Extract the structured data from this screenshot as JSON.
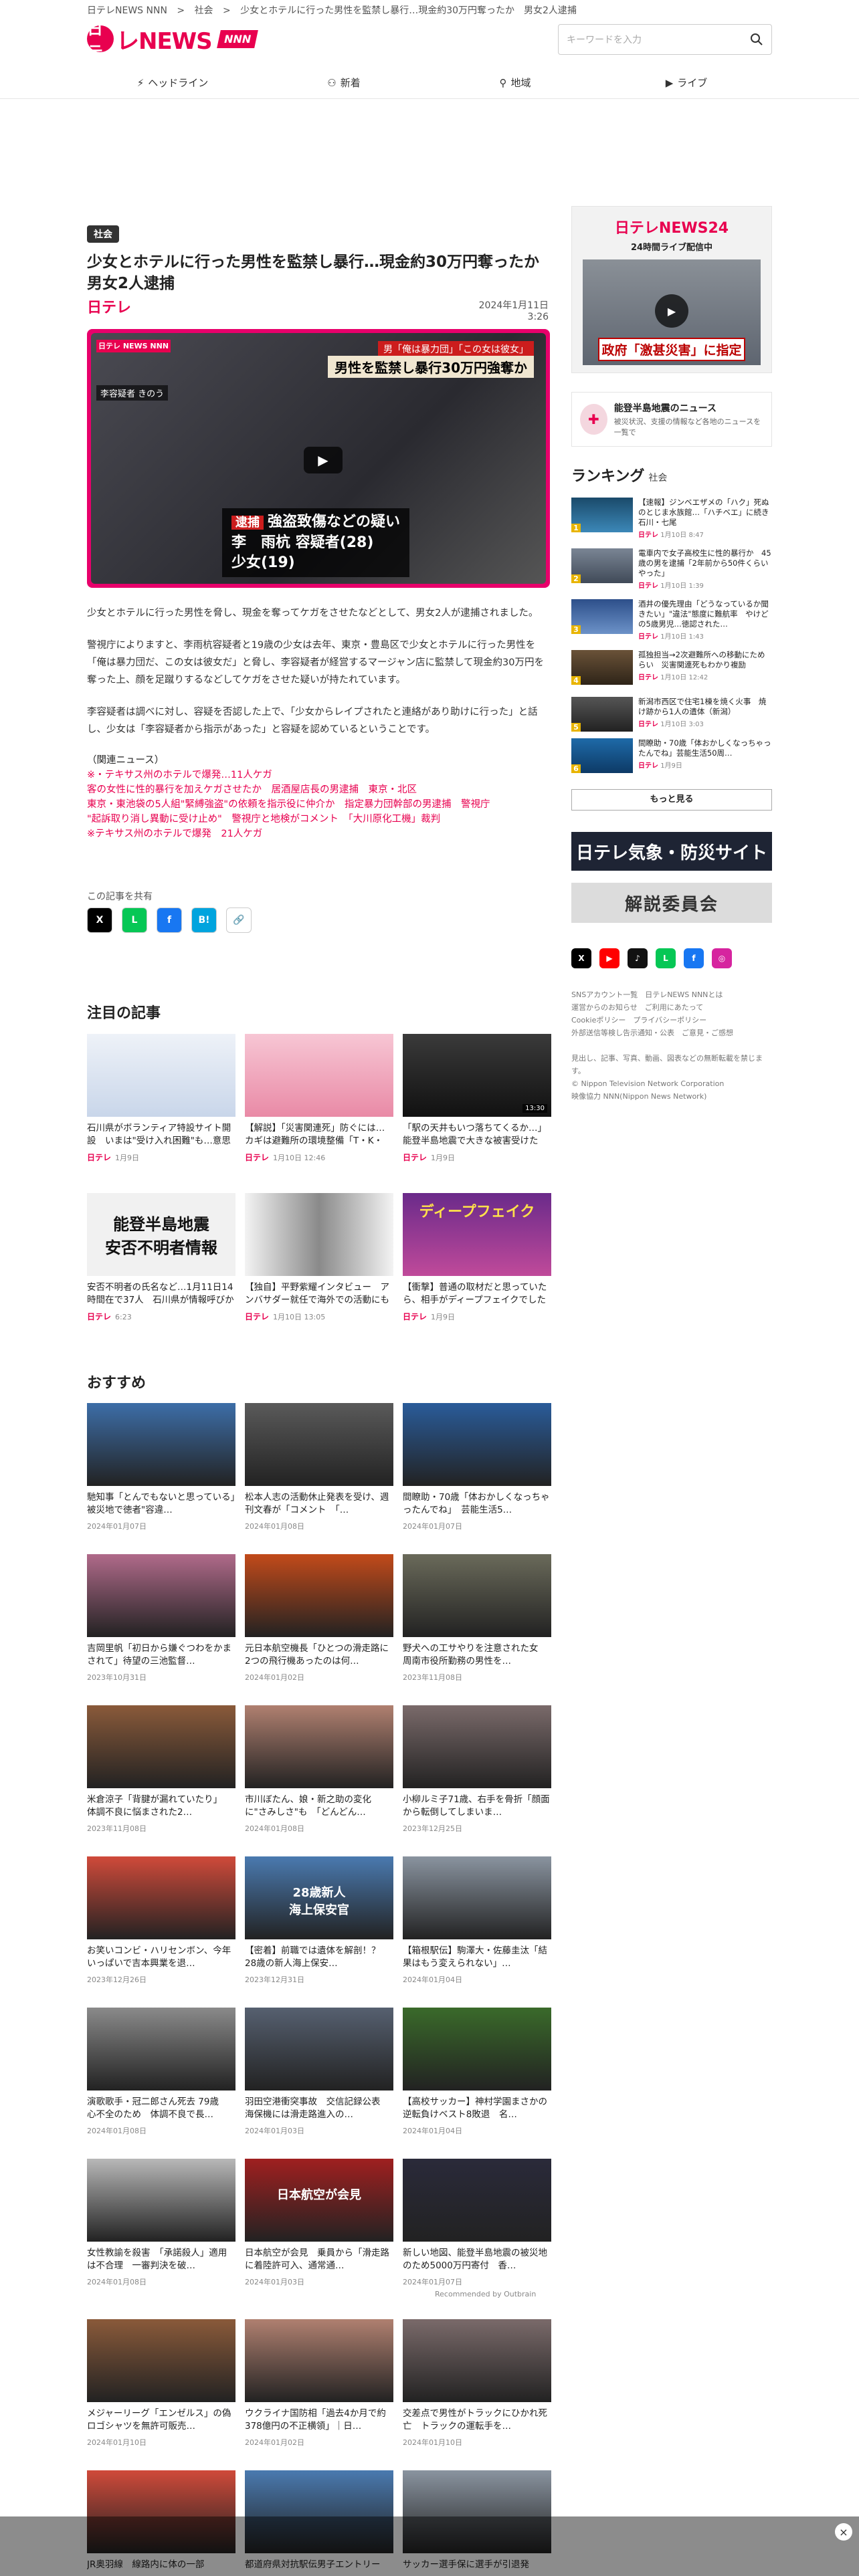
{
  "breadcrumb": [
    "日テレNEWS NNN",
    ">",
    "社会",
    ">",
    "少女とホテルに行った男性を監禁し暴行…現金約30万円奪ったか　男女2人逮捕"
  ],
  "logo": {
    "part1": "日テ",
    "part2": "レNEWS",
    "part3": "NNN"
  },
  "search": {
    "placeholder": "キーワードを入力"
  },
  "nav": [
    {
      "icon": "⚡",
      "label": "ヘッドライン"
    },
    {
      "icon": "⚇",
      "label": "新着"
    },
    {
      "icon": "⚲",
      "label": "地域"
    },
    {
      "icon": "▶",
      "label": "ライブ"
    }
  ],
  "article": {
    "category": "社会",
    "title": "少女とホテルに行った男性を監禁し暴行…現金約30万円奪ったか　男女2人逮捕",
    "brand": "日テレ",
    "date": "2024年1月11日 3:26",
    "hero": {
      "brand_badge": "日テレ NEWS NNN",
      "suspect": "李容疑者 きのう",
      "caption_top": "男「俺は暴力団」「この女は彼女」",
      "caption_main": "男性を監禁し暴行30万円強奪か",
      "arrest": "逮捕",
      "charge": "強盗致傷などの疑い",
      "name1": "李　雨杭 容疑者(28)",
      "name2": "少女(19)"
    },
    "paragraphs": [
      "少女とホテルに行った男性を脅し、現金を奪ってケガをさせたなどとして、男女2人が逮捕されました。",
      "警視庁によりますと、李雨杭容疑者と19歳の少女は去年、東京・豊島区で少女とホテルに行った男性を「俺は暴力団だ、この女は彼女だ」と脅し、李容疑者が経営するマージャン店に監禁して現金約30万円を奪った上、顔を足蹴りするなどしてケガをさせた疑いが持たれています。",
      "李容疑者は調べに対し、容疑を否認した上で、「少女からレイプされたと連絡があり助けに行った」と話し、少女は「李容疑者から指示があった」と容疑を認めているということです。"
    ],
    "related_heading": "（関連ニュース）",
    "related": [
      "※・テキサス州のホテルで爆発…11人ケガ",
      "客の女性に性的暴行を加えケガさせたか　居酒屋店長の男逮捕　東京・北区",
      "東京・東池袋の5人組\"緊縛強盗\"の依頼を指示役に仲介か　指定暴力団幹部の男逮捕　警視庁",
      "\"起訴取り消し異動に受け止め\"　警視庁と地検がコメント　「大川原化工機」裁判",
      "※テキサス州のホテルで爆発　21人ケガ"
    ],
    "share_label": "この記事を共有",
    "share": [
      "X",
      "L",
      "f",
      "B!",
      "🔗"
    ]
  },
  "sidebar": {
    "live": {
      "title": "日テレNEWS24",
      "subtitle": "24時間ライブ配信中",
      "caption": "政府「激甚災害」に指定"
    },
    "quake": {
      "title": "能登半島地震のニュース",
      "desc": "被災状況、支援の情報など各地のニュースを一覧で"
    },
    "ranking_title": "ランキング",
    "ranking_cat": "社会",
    "ranking": [
      {
        "n": "1",
        "text": "【速報】ジンベエザメの「ハク」死ぬ　のとじま水族館…「ハチベエ」に続き　石川・七尾",
        "brand": "日テレ",
        "time": "1月10日 8:47"
      },
      {
        "n": "2",
        "text": "電車内で女子高校生に性的暴行か　45歳の男を逮捕「2年前から50件くらいやった」",
        "brand": "日テレ",
        "time": "1月10日 1:39"
      },
      {
        "n": "3",
        "text": "酒井の優先理由「どうなっているか聞きたい」\"違法\"態度に難航率　やけどの5歳男児…徳認された…",
        "brand": "日テレ",
        "time": "1月10日 1:43"
      },
      {
        "n": "4",
        "text": "孤独担当→2次避難所への移動にためらい　災害関連死もわかり複励",
        "brand": "日テレ",
        "time": "1月10日 12:42"
      },
      {
        "n": "5",
        "text": "新潟市西区で住宅1棟を焼く火事　焼け跡から1人の遺体（新潟）",
        "brand": "日テレ",
        "time": "1月10日 3:03"
      },
      {
        "n": "6",
        "text": "間瞭助・70歳「体おかしくなっちゃったんでね」芸能生活50周…",
        "brand": "日テレ",
        "time": "1月9日"
      }
    ],
    "more": "もっと見る",
    "tenki": "日テレ気象・防災サイト",
    "kaisetsu": "解説委員会",
    "sns": [
      "X",
      "▶",
      "♪",
      "L",
      "f",
      "◎"
    ],
    "footer_links": [
      "SNSアカウント一覧　日テレNEWS NNNとは",
      "運営からのお知らせ　ご利用にあたって",
      "Cookieポリシー　プライバシーポリシー",
      "外部送信等検し告示通知・公表　ご意見・ご感想",
      "",
      "見出し、記事、写真、動画、図表などの無断転載を禁じます。",
      "© Nippon Television Network Corporation",
      "映像協力 NNN(Nippon News Network)"
    ]
  },
  "featured": {
    "heading": "注目の記事",
    "items": [
      {
        "title": "石川県がボランティア特設サイト開設　いまは\"受け入れ困難\"も…意思ある人は「事前登…",
        "brand": "日テレ",
        "time": "1月9日"
      },
      {
        "title": "【解説】「災害関連死」防ぐには…カギは避難所の環境整備「T・K・B」？　「2次避難」…",
        "brand": "日テレ",
        "time": "1月10日 12:46"
      },
      {
        "title": "「駅の天井もいつ落ちてくるか…」　能登半島地震で大きな被害受けた「のと鉄道」　鉄…",
        "brand": "日テレ",
        "time": "1月9日",
        "dur": "13:30"
      },
      {
        "title": "安否不明者の氏名など…1月11日14 時間在で37人　石川県が情報呼びかけ",
        "brand": "日テレ",
        "time": "6:23",
        "banner1": "能登半島地震",
        "banner2": "安否不明者情報"
      },
      {
        "title": "【独自】平野紫耀インタビュー　アンバサダー就任で海外での活動にも意欲「果敢にトライし…",
        "brand": "日テレ",
        "time": "1月10日 13:05"
      },
      {
        "title": "【衝撃】普通の取材だと思っていたら、相手がディープフェイクでした【#みんなのギモンD…",
        "brand": "日テレ",
        "time": "1月9日",
        "banner1": "ディープフェイク"
      }
    ]
  },
  "recommend": {
    "heading": "おすすめ",
    "outbrain": "Recommended by Outbrain",
    "items": [
      {
        "title": "馳知事「とんでもないと思っている」　被災地で徳者\"容違…",
        "time": "2024年01月07日"
      },
      {
        "title": "松本人志の活動休止発表を受け、週刊文春が「コメント　「…",
        "time": "2024年01月08日"
      },
      {
        "title": "間瞭助・70歳「体おかしくなっちゃったんでね」　芸能生活5…",
        "time": "2024年01月07日"
      },
      {
        "title": "吉岡里帆「初日から嫌ぐつわをかまされて」待望の三池監督…",
        "time": "2023年10月31日"
      },
      {
        "title": "元日本航空機長「ひとつの滑走路に2つの飛行機あったのは何…",
        "time": "2024年01月02日"
      },
      {
        "title": "野犬への工サやりを注意された女　周南市役所勤務の男性を…",
        "time": "2023年11月08日"
      },
      {
        "title": "米倉涼子「背腱が漏れていたり」　体調不良に悩まされた2…",
        "time": "2023年11月08日"
      },
      {
        "title": "市川ぼたん、娘・新之助の変化に\"さみしさ\"も　「どんどん…",
        "time": "2024年01月08日"
      },
      {
        "title": "小柳ルミ子71歳、右手を骨折「顔面から転倒してしまいま…",
        "time": "2023年12月25日"
      },
      {
        "title": "お笑いコンビ・ハリセンボン、今年いっぱいで吉本興業を退…",
        "time": "2023年12月26日"
      },
      {
        "title": "【密着】前職では遺体を解剖！？　28歳の新人海上保安…",
        "time": "2023年12月31日",
        "banner1": "28歳新人",
        "banner2": "海上保安官"
      },
      {
        "title": "【箱根駅伝】駒澤大・佐藤圭汰「結果はもう変えられない」…",
        "time": "2024年01月04日"
      },
      {
        "title": "演歌歌手・冠二郎さん死去 79歳　心不全のため　体調不良で長…",
        "time": "2024年01月08日"
      },
      {
        "title": "羽田空港衝突事故　交信記録公表　海保機には滑走路進入の…",
        "time": "2024年01月03日"
      },
      {
        "title": "【高校サッカー】神村学園まさかの逆転負けベスト8敗退　名…",
        "time": "2024年01月04日"
      },
      {
        "title": "女性教諭を殺害　「承諾殺人」適用は不合理　一審判決を破…",
        "time": "2024年01月08日"
      },
      {
        "title": "日本航空が会見　乗員から「滑走路に着陸許可入、通常通…",
        "time": "2024年01月03日",
        "banner1": "日本航空が会見"
      },
      {
        "title": "新しい地図、能登半島地震の被災地のため5000万円寄付　香…",
        "time": "2024年01月07日"
      }
    ],
    "items2": [
      {
        "title": "メジャーリーグ「エンゼルス」の偽ロゴシャツを無許可販売…",
        "time": "2024年01月10日"
      },
      {
        "title": "ウクライナ国防相「過去4か月で約378億円の不正横領」｜日…",
        "time": "2024年01月02日"
      },
      {
        "title": "交差点で男性がトラックにひかれ死亡　トラックの運転手を…",
        "time": "2024年01月10日"
      },
      {
        "title": "JR奥羽線　線路内に体の一部",
        "time": ""
      },
      {
        "title": "都道府県対抗駅伝男子エントリー",
        "time": ""
      },
      {
        "title": "サッカー選手保に選手が引退発",
        "time": ""
      }
    ]
  },
  "colors": {
    "brand": "#e8004f",
    "dark": "#1e2434"
  },
  "close_label": "×"
}
